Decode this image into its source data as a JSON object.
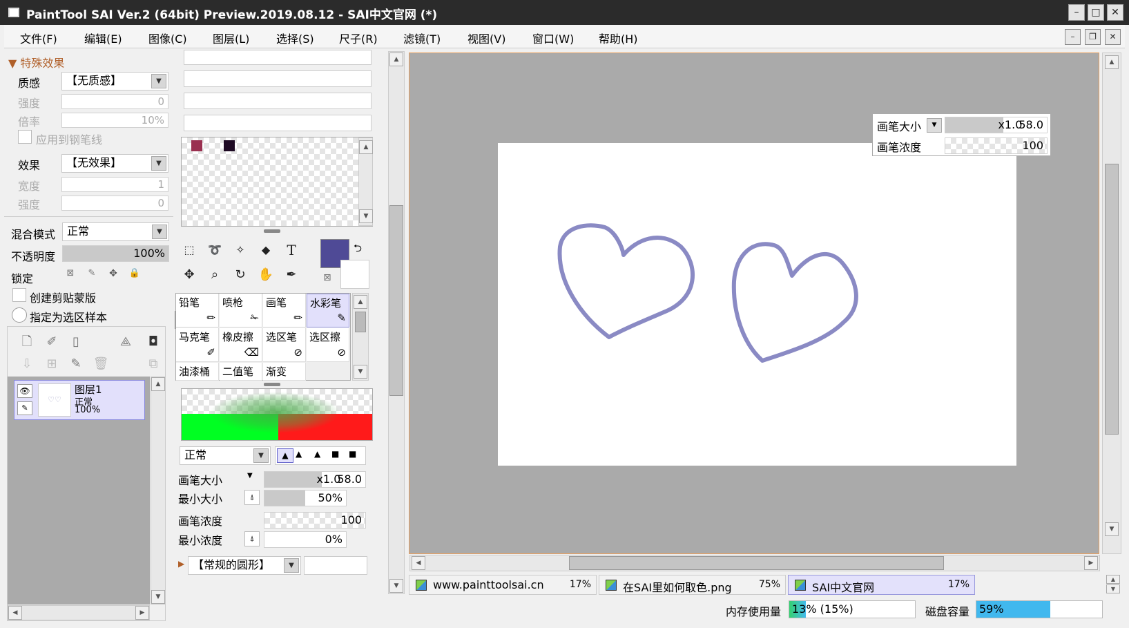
{
  "window": {
    "title": "PaintTool SAI Ver.2 (64bit) Preview.2019.08.12 - SAI中文官网 (*)"
  },
  "menu": [
    "文件(F)",
    "编辑(E)",
    "图像(C)",
    "图层(L)",
    "选择(S)",
    "尺子(R)",
    "滤镜(T)",
    "视图(V)",
    "窗口(W)",
    "帮助(H)"
  ],
  "effects": {
    "header": "特殊效果",
    "texture_label": "质感",
    "texture_value": "【无质感】",
    "strength_label": "强度",
    "strength_value": "0",
    "ratio_label": "倍率",
    "ratio_value": "10%",
    "apply_pen_label": "应用到钢笔线",
    "effect_label": "效果",
    "effect_value": "【无效果】",
    "width_label": "宽度",
    "width_value": "1",
    "strength2_label": "强度",
    "strength2_value": "0"
  },
  "layerprops": {
    "blend_label": "混合模式",
    "blend_value": "正常",
    "opacity_label": "不透明度",
    "opacity_value": "100%",
    "lock_label": "锁定",
    "clip_label": "创建剪贴蒙版",
    "sample_label": "指定为选区样本"
  },
  "layers": [
    {
      "name": "图层1",
      "mode": "正常",
      "opacity": "100%"
    }
  ],
  "tools": [
    [
      "铅笔",
      "喷枪",
      "画笔",
      "水彩笔"
    ],
    [
      "马克笔",
      "橡皮擦",
      "选区笔",
      "选区擦"
    ],
    [
      "油漆桶",
      "二值笔",
      "渐变",
      ""
    ]
  ],
  "selected_tool": "水彩笔",
  "colors": {
    "primary": "#4f4a96",
    "swatch1": "#9a3050",
    "swatch2": "#1e0a24",
    "stroke": "#8a8ac4"
  },
  "brush": {
    "mode": "正常",
    "size_label": "画笔大小",
    "size_mult": "x1.0",
    "size_value": "58.0",
    "min_size_label": "最小大小",
    "min_size_value": "50%",
    "density_label": "画笔浓度",
    "density_value": "100",
    "min_density_label": "最小浓度",
    "min_density_value": "0%",
    "shape_value": "【常规的圆形】"
  },
  "overlay": {
    "size_label": "画笔大小",
    "size_mult": "x1.0",
    "size_value": "58.0",
    "density_label": "画笔浓度",
    "density_value": "100"
  },
  "tabs": [
    {
      "name": "www.painttoolsai.cn",
      "percent": "17%"
    },
    {
      "name": "在SAI里如何取色.png",
      "percent": "75%"
    },
    {
      "name": "SAI中文官网",
      "percent": "17%"
    }
  ],
  "status": {
    "memory_label": "内存使用量",
    "memory_value": "13% (15%)",
    "memory_fraction": 0.13,
    "disk_label": "磁盘容量",
    "disk_value": "59%",
    "disk_fraction": 0.59
  }
}
